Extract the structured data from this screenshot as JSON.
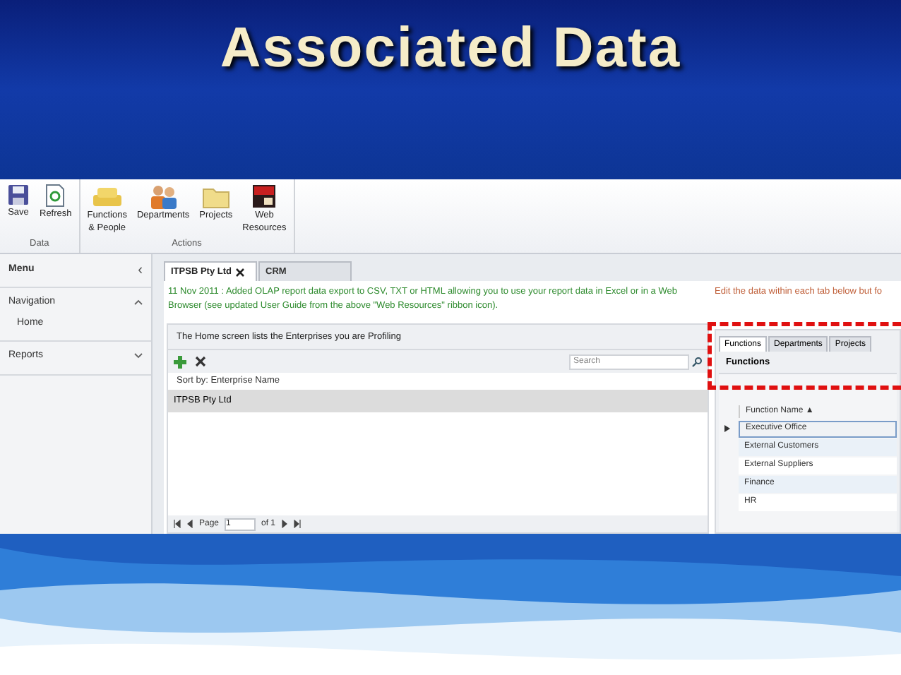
{
  "slide_title": "Associated Data",
  "ribbon": {
    "groups": [
      {
        "label": "Data",
        "buttons": [
          {
            "kind": "save",
            "label": "Save"
          },
          {
            "kind": "refresh",
            "label": "Refresh"
          }
        ]
      },
      {
        "label": "Actions",
        "buttons": [
          {
            "kind": "functions",
            "label": "Functions\n& People"
          },
          {
            "kind": "departments",
            "label": "Departments"
          },
          {
            "kind": "projects",
            "label": "Projects"
          },
          {
            "kind": "web",
            "label": "Web\nResources"
          }
        ]
      }
    ]
  },
  "sidebar": {
    "title": "Menu",
    "collapse_glyph": "‹",
    "sections": [
      {
        "label": "Navigation",
        "expanded": true,
        "items": [
          {
            "label": "Home"
          }
        ]
      },
      {
        "label": "Reports",
        "expanded": false
      }
    ]
  },
  "tabs": [
    {
      "label": "ITPSB Pty Ltd",
      "selected": true,
      "closable": true
    },
    {
      "label": "CRM",
      "selected": false,
      "closable": false
    }
  ],
  "notice": "11 Nov 2011 :  Added OLAP report data export to CSV, TXT or HTML allowing you to use your report data in Excel or in a Web Browser (see updated User Guide from the above \"Web Resources\" ribbon icon).",
  "enterprises": {
    "title": "The Home screen lists the Enterprises you are Profiling",
    "search": {
      "placeholder": "Search"
    },
    "sort_label": "Sort by: Enterprise Name",
    "rows": [
      {
        "name": "ITPSB Pty Ltd",
        "selected": true
      }
    ],
    "pager": {
      "page_label": "Page",
      "page": "1",
      "of": "of 1"
    }
  },
  "details": {
    "hint": "Edit the data within each tab below but fo",
    "tabs": [
      {
        "label": "Functions",
        "selected": true
      },
      {
        "label": "Departments",
        "selected": false
      },
      {
        "label": "Projects",
        "selected": false
      }
    ],
    "panel_title": "Functions",
    "column": "Function Name ▲",
    "rows": [
      {
        "name": "Executive Office",
        "selected": true
      },
      {
        "name": "External Customers",
        "selected": false
      },
      {
        "name": "External Suppliers",
        "selected": false
      },
      {
        "name": "Finance",
        "selected": false
      },
      {
        "name": "HR",
        "selected": false
      }
    ]
  }
}
